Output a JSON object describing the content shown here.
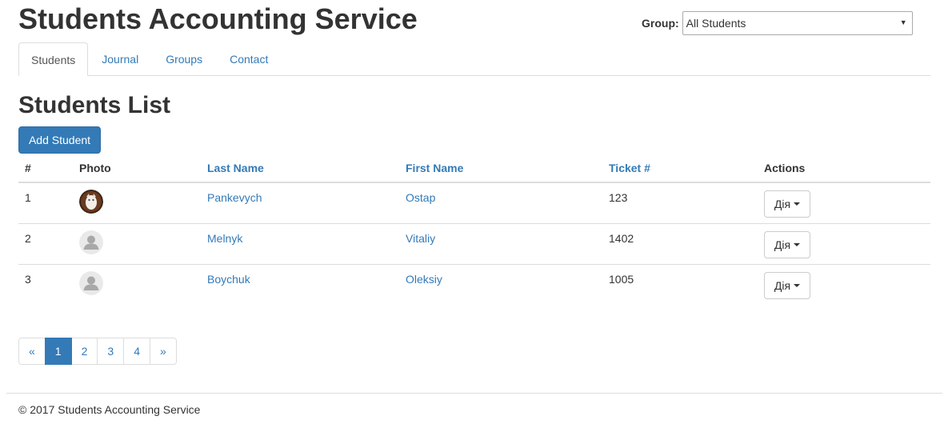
{
  "header": {
    "title": "Students Accounting Service",
    "group_label": "Group:",
    "group_selected": "All Students"
  },
  "tabs": [
    {
      "label": "Students",
      "active": true
    },
    {
      "label": "Journal",
      "active": false
    },
    {
      "label": "Groups",
      "active": false
    },
    {
      "label": "Contact",
      "active": false
    }
  ],
  "main": {
    "title": "Students List",
    "add_button": "Add Student"
  },
  "table": {
    "columns": [
      "#",
      "Photo",
      "Last Name",
      "First Name",
      "Ticket #",
      "Actions"
    ],
    "rows": [
      {
        "num": "1",
        "photo": "custom-photo",
        "last_name": "Pankevych",
        "first_name": "Ostap",
        "ticket": "123",
        "action": "Дія"
      },
      {
        "num": "2",
        "photo": "default-avatar-icon",
        "last_name": "Melnyk",
        "first_name": "Vitaliy",
        "ticket": "1402",
        "action": "Дія"
      },
      {
        "num": "3",
        "photo": "default-avatar-icon",
        "last_name": "Boychuk",
        "first_name": "Oleksiy",
        "ticket": "1005",
        "action": "Дія"
      }
    ]
  },
  "pagination": {
    "prev": "«",
    "pages": [
      "1",
      "2",
      "3",
      "4"
    ],
    "current": "1",
    "next": "»"
  },
  "footer": {
    "text": "© 2017 Students Accounting Service"
  },
  "colors": {
    "accent": "#337ab7",
    "border": "#dddddd",
    "text": "#333333"
  }
}
